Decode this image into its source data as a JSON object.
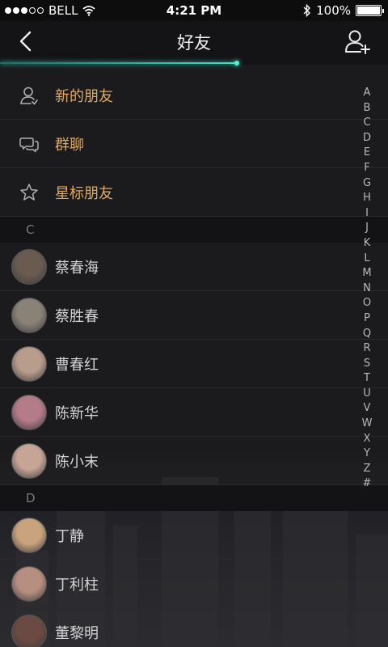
{
  "status_bar": {
    "carrier": "BELL",
    "time": "4:21 PM",
    "battery": "100%"
  },
  "nav": {
    "title": "好友",
    "back_icon": "chevron-left-icon",
    "add_icon": "add-friend-icon"
  },
  "progress": {
    "fraction": 0.61,
    "color": "#43e0c4"
  },
  "functions": [
    {
      "label": "新的朋友",
      "icon": "person-icon"
    },
    {
      "label": "群聊",
      "icon": "chat-bubbles-icon"
    },
    {
      "label": "星标朋友",
      "icon": "star-icon"
    }
  ],
  "sections": [
    {
      "letter": "C",
      "friends": [
        {
          "name": "蔡春海",
          "avatar_color": "#6a5b50"
        },
        {
          "name": "蔡胜春",
          "avatar_color": "#8a8177"
        },
        {
          "name": "曹春红",
          "avatar_color": "#b89c8c"
        },
        {
          "name": "陈新华",
          "avatar_color": "#b47c88"
        },
        {
          "name": "陈小末",
          "avatar_color": "#c6a596"
        }
      ]
    },
    {
      "letter": "D",
      "friends": [
        {
          "name": "丁静",
          "avatar_color": "#c9a37e"
        },
        {
          "name": "丁利柱",
          "avatar_color": "#b78f80"
        },
        {
          "name": "董黎明",
          "avatar_color": "#6b4a43"
        }
      ]
    }
  ],
  "index_letters": [
    "A",
    "B",
    "C",
    "D",
    "E",
    "F",
    "G",
    "H",
    "I",
    "J",
    "K",
    "L",
    "M",
    "N",
    "O",
    "P",
    "Q",
    "R",
    "S",
    "T",
    "U",
    "V",
    "W",
    "X",
    "Y",
    "Z",
    "#"
  ],
  "colors": {
    "accent_label": "#e2a85d",
    "background": "#1b1b1d"
  }
}
